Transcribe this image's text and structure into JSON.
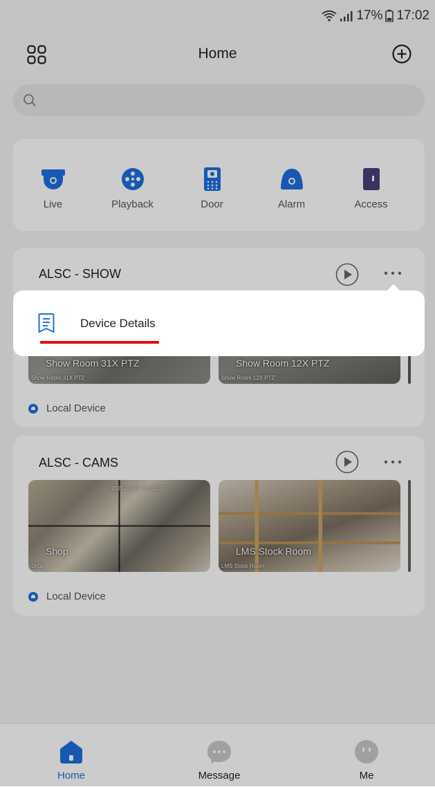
{
  "status": {
    "battery": "17%",
    "time": "17:02"
  },
  "header": {
    "title": "Home",
    "grid_icon": "grid-icon",
    "add_icon": "plus-circle-icon"
  },
  "search": {
    "placeholder": "",
    "value": ""
  },
  "quick": [
    {
      "label": "Live",
      "icon": "live-camera-icon"
    },
    {
      "label": "Playback",
      "icon": "playback-icon"
    },
    {
      "label": "Door",
      "icon": "door-icon"
    },
    {
      "label": "Alarm",
      "icon": "alarm-icon"
    },
    {
      "label": "Access",
      "icon": "access-icon"
    }
  ],
  "devices": [
    {
      "name": "ALSC - SHOW",
      "cameras": [
        {
          "caption": "Show Room 31X PTZ",
          "small": "Show Room 31X PTZ"
        },
        {
          "caption": "Show Room 12X PTZ",
          "small": "Show Room 12X PTZ"
        }
      ],
      "local_label": "Local Device"
    },
    {
      "name": "ALSC - CAMS",
      "cameras": [
        {
          "caption": "Shop",
          "small": "Shop",
          "stamp": "2022-01-07 17:02:07"
        },
        {
          "caption": "LMS Stock Room",
          "small": "LMS Stock Room"
        }
      ],
      "local_label": "Local Device"
    }
  ],
  "popup": {
    "label": "Device Details",
    "icon": "document-icon"
  },
  "tabs": [
    {
      "label": "Home",
      "icon": "home-icon",
      "active": true
    },
    {
      "label": "Message",
      "icon": "message-icon",
      "active": false
    },
    {
      "label": "Me",
      "icon": "profile-icon",
      "active": false
    }
  ],
  "colors": {
    "accent": "#1e6fe0",
    "underline": "#e01010",
    "background": "#f2f3f5"
  }
}
